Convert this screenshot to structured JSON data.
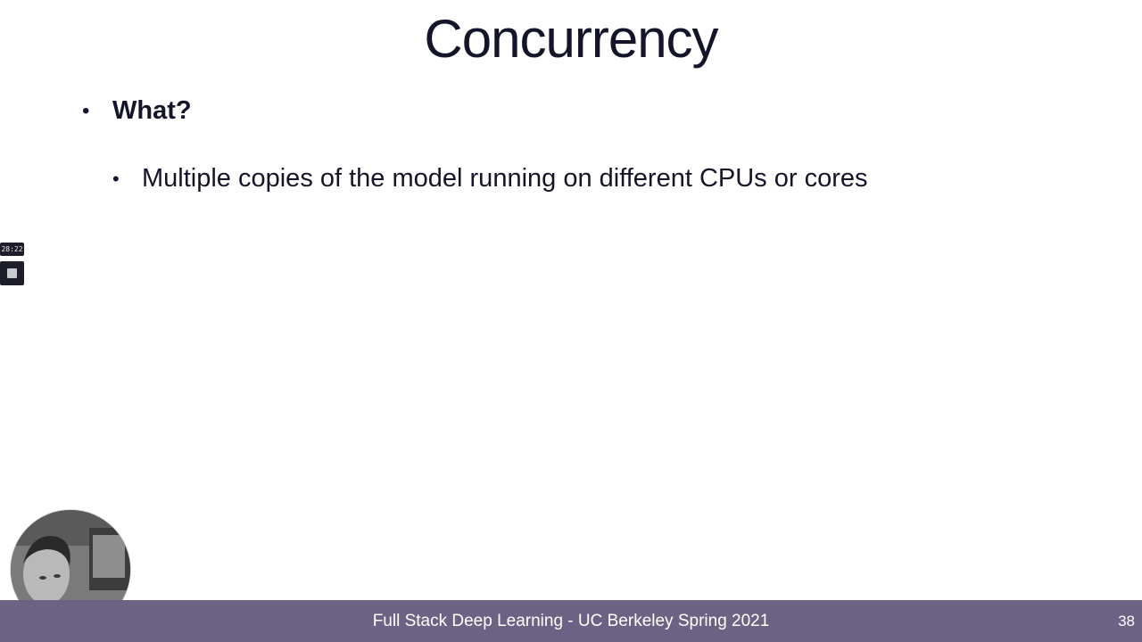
{
  "slide": {
    "title": "Concurrency",
    "bullets": [
      {
        "text": "What?",
        "sub_bullets": [
          "Multiple copies of the model running on different CPUs or cores"
        ]
      }
    ]
  },
  "recorder": {
    "elapsed_time": "28:22"
  },
  "footer": {
    "text": "Full Stack Deep Learning - UC Berkeley Spring 2021",
    "page_number": "38"
  },
  "colors": {
    "footer_bar": "#6c6384",
    "text": "#15152a",
    "background": "#ffffff"
  }
}
